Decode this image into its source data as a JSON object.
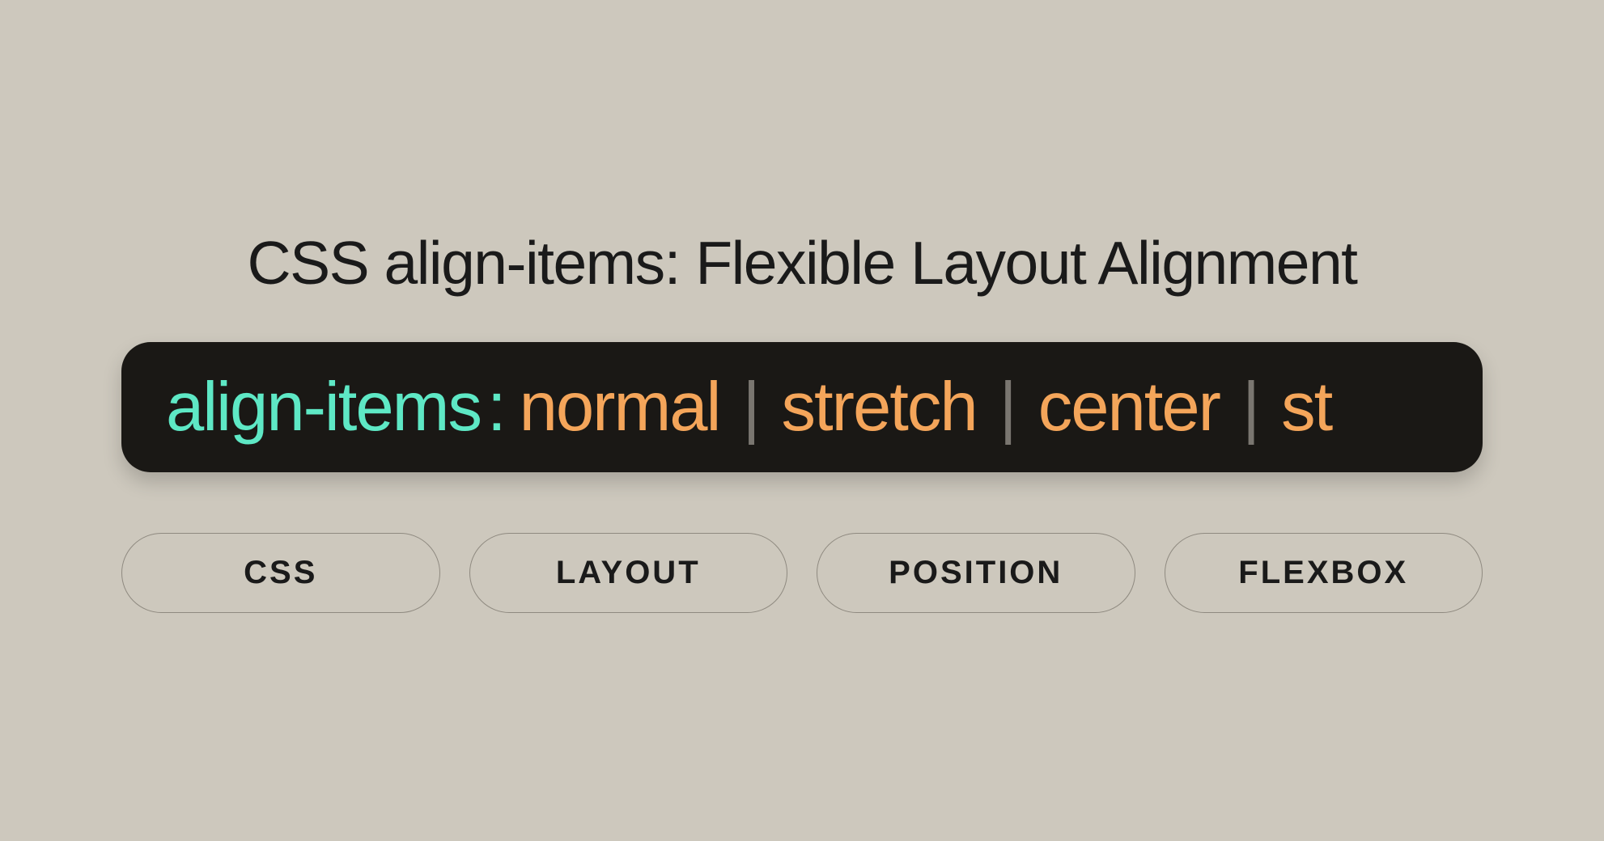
{
  "heading": "CSS align-items: Flexible Layout Alignment",
  "code": {
    "property": "align-items",
    "colon": ":",
    "values": [
      "normal",
      "stretch",
      "center",
      "st"
    ],
    "separator": "|"
  },
  "tags": [
    "CSS",
    "LAYOUT",
    "POSITION",
    "FLEXBOX"
  ]
}
